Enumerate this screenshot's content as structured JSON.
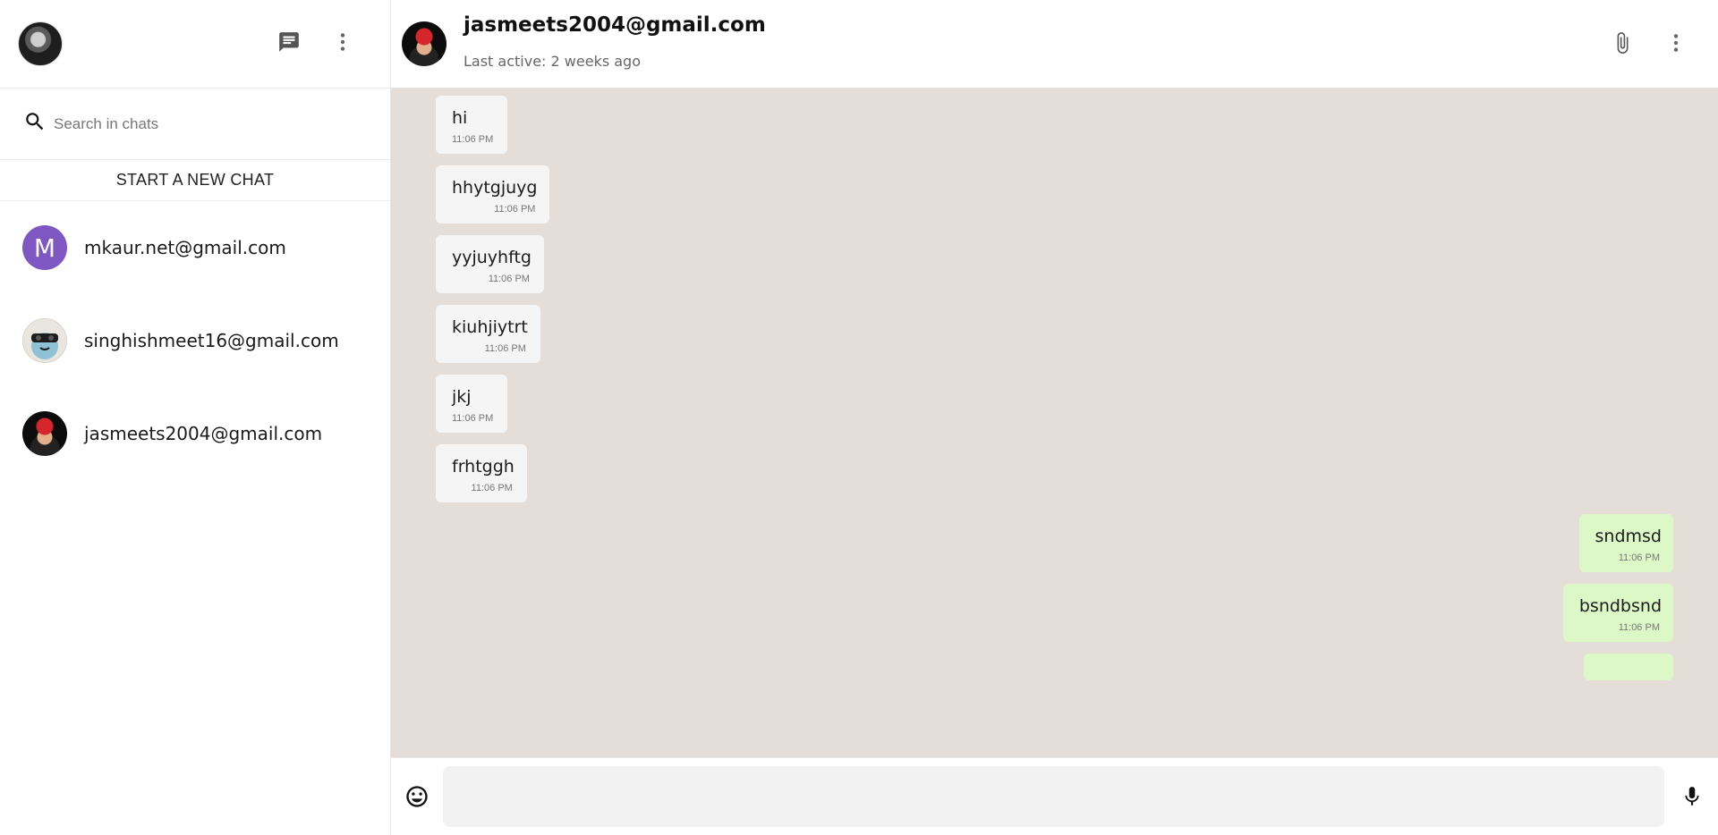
{
  "sidebar": {
    "search": {
      "placeholder": "Search in chats"
    },
    "new_chat_label": "START A NEW CHAT",
    "chats": [
      {
        "name": "mkaur.net@gmail.com",
        "avatar_letter": "M"
      },
      {
        "name": "singhishmeet16@gmail.com"
      },
      {
        "name": "jasmeets2004@gmail.com"
      }
    ]
  },
  "conversation": {
    "title": "jasmeets2004@gmail.com",
    "last_active": "Last active: 2 weeks ago",
    "messages": [
      {
        "text": "hi",
        "time": "11:06 PM",
        "direction": "in"
      },
      {
        "text": "hhytgjuyg",
        "time": "11:06 PM",
        "direction": "in"
      },
      {
        "text": "yyjuyhftg",
        "time": "11:06 PM",
        "direction": "in"
      },
      {
        "text": "kiuhjiytrt",
        "time": "11:06 PM",
        "direction": "in"
      },
      {
        "text": "jkj",
        "time": "11:06 PM",
        "direction": "in"
      },
      {
        "text": "frhtggh",
        "time": "11:06 PM",
        "direction": "in"
      },
      {
        "text": "sndmsd",
        "time": "11:06 PM",
        "direction": "out"
      },
      {
        "text": "bsndbsnd",
        "time": "11:06 PM",
        "direction": "out"
      }
    ]
  },
  "composer": {
    "placeholder": ""
  },
  "colors": {
    "chat_background": "#e5ded8",
    "incoming_bubble": "#f5f5f5",
    "outgoing_bubble": "#dcf8c6",
    "avatar_m": "#7e57c2"
  },
  "icons": {
    "sidebar": [
      "new-chat-icon",
      "more-vert-icon",
      "search-icon"
    ],
    "header": [
      "attach-icon",
      "more-vert-icon"
    ],
    "composer": [
      "emoji-icon",
      "mic-icon"
    ]
  }
}
